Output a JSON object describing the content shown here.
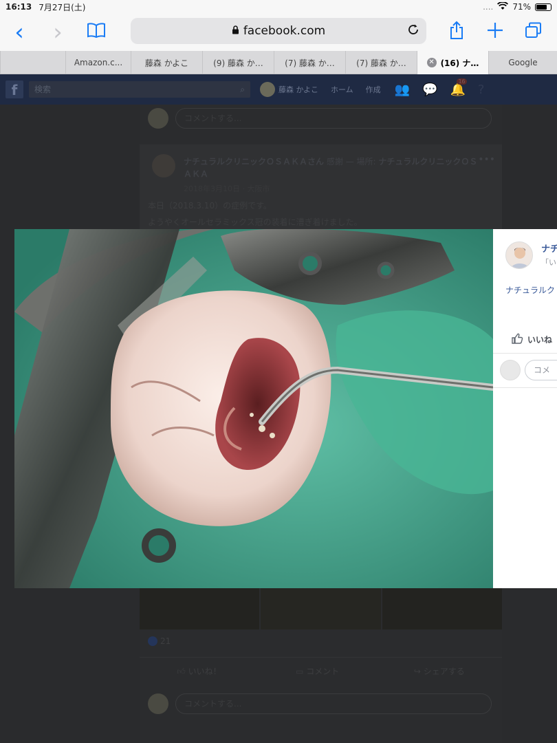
{
  "status": {
    "time": "16:13",
    "date": "7月27日(土)",
    "battery": "71%",
    "signal": "....",
    "wifi": "wifi-icon"
  },
  "nav": {
    "back": "‹",
    "forward": "›",
    "url": "facebook.com"
  },
  "tabs": [
    {
      "label": "",
      "active": false
    },
    {
      "label": "Amazon.c...",
      "active": false
    },
    {
      "label": "藤森 かよこ",
      "active": false
    },
    {
      "label": "(9) 藤森 か…",
      "active": false
    },
    {
      "label": "(7) 藤森 か…",
      "active": false
    },
    {
      "label": "(7) 藤森 か…",
      "active": false
    },
    {
      "label": "(16) ナ…",
      "active": true
    },
    {
      "label": "Google",
      "active": false
    }
  ],
  "fb": {
    "logo": "f",
    "search_placeholder": "検索",
    "user_name": "藤森 かよこ",
    "home": "ホーム",
    "create": "作成",
    "notification_count": "16"
  },
  "feed": {
    "comment_placeholder": "コメントする...",
    "post_author": "ナチュラルクリニックＯＳＡＫＡさん",
    "post_feeling": "感謝",
    "post_place_prefix": "— 場所:",
    "post_place": "ナチュラルクリニックＯＳＡＫＡ",
    "post_date": "2018年3月10日 · 大阪市",
    "post_line1": "本日（2018.3.10）の症例です。",
    "post_line2": "ようやくオールセラミックス冠の装着に漕ぎ着けました。",
    "reaction_count": "21",
    "like": "いいね！",
    "comment": "コメント",
    "share": "シェアする"
  },
  "panel": {
    "name": "ナチ",
    "sub": "「い",
    "link": "ナチュラルク",
    "like": "いいね",
    "comment_placeholder": "コメ"
  }
}
